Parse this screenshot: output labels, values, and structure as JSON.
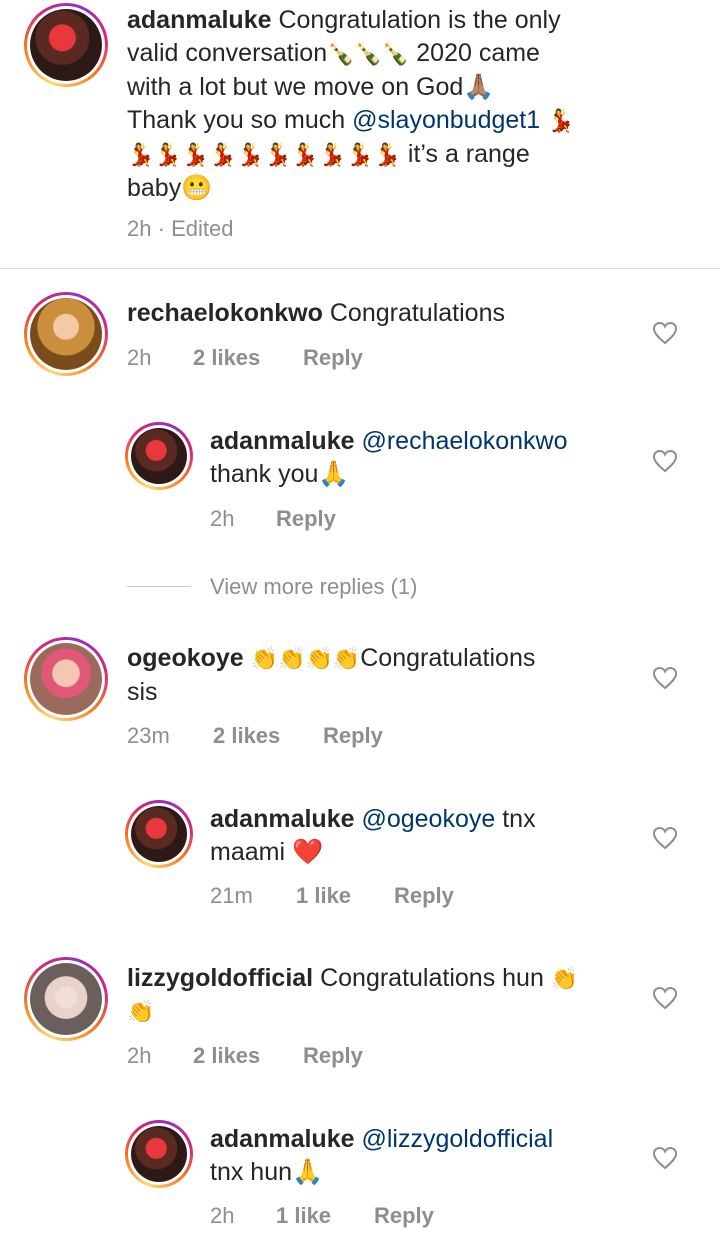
{
  "caption": {
    "username": "adanmaluke",
    "line1": "Congratulation is the only",
    "line2a": "valid conversation",
    "line2_emoji": "🍾🍾🍾",
    "line2b": "2020 came",
    "line3": "with a lot but we move on God🙏🏽",
    "line4a": "Thank you so much",
    "line4_mention": "@slayonbudget1",
    "line4_emoji": "💃",
    "line5_emoji": "💃💃💃💃💃💃💃💃💃💃",
    "line5b": "it’s a range",
    "line6": "baby😬",
    "time": "2h",
    "sep": "·",
    "edited": "Edited"
  },
  "comments": [
    {
      "username": "rechaelokonkwo",
      "text": "Congratulations",
      "time": "2h",
      "likes": "2 likes",
      "reply": "Reply"
    },
    {
      "username": "adanmaluke",
      "mention": "@rechaelokonkwo",
      "text2": "thank you🙏",
      "time": "2h",
      "reply": "Reply"
    },
    {
      "username": "ogeokoye",
      "emoji": "👏👏👏👏",
      "text": "Congratulations",
      "text2": "sis",
      "time": "23m",
      "likes": "2 likes",
      "reply": "Reply"
    },
    {
      "username": "adanmaluke",
      "mention": "@ogeokoye",
      "text": "tnx",
      "text2": "maami ❤️",
      "time": "21m",
      "likes": "1 like",
      "reply": "Reply"
    },
    {
      "username": "lizzygoldofficial",
      "text": "Congratulations hun",
      "emoji": "👏",
      "text2": "👏",
      "time": "2h",
      "likes": "2 likes",
      "reply": "Reply"
    },
    {
      "username": "adanmaluke",
      "mention": "@lizzygoldofficial",
      "text2": "tnx hun🙏",
      "time": "2h",
      "likes": "1 like",
      "reply": "Reply"
    }
  ],
  "view_more": "View more replies (1)",
  "icons": {
    "heart": "heart-outline-icon",
    "avatar": "profile-avatar"
  },
  "colors": {
    "text": "#262626",
    "meta": "#8e8e8e",
    "mention": "#00376b",
    "heart_stroke": "#8e8e8e"
  }
}
